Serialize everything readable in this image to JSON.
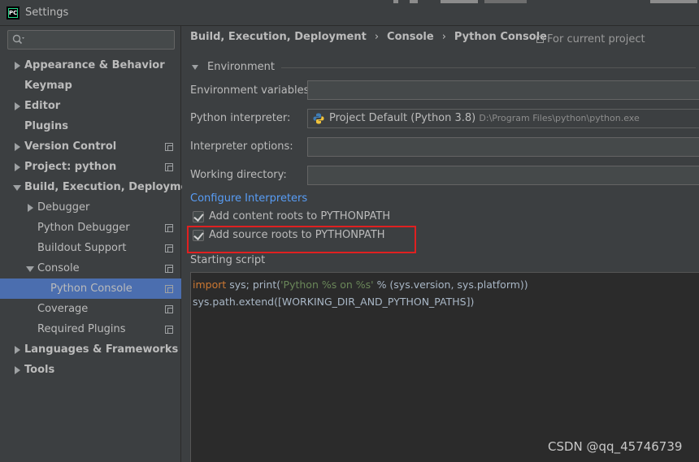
{
  "window": {
    "title": "Settings"
  },
  "search": {
    "placeholder": "",
    "value": ""
  },
  "tree": [
    {
      "label": "Appearance & Behavior",
      "bold": true,
      "expand": "right",
      "indent": 0,
      "copy": false
    },
    {
      "label": "Keymap",
      "bold": true,
      "expand": "none",
      "indent": 0,
      "copy": false
    },
    {
      "label": "Editor",
      "bold": true,
      "expand": "right",
      "indent": 0,
      "copy": false
    },
    {
      "label": "Plugins",
      "bold": true,
      "expand": "none",
      "indent": 0,
      "copy": false
    },
    {
      "label": "Version Control",
      "bold": true,
      "expand": "right",
      "indent": 0,
      "copy": true
    },
    {
      "label": "Project: python",
      "bold": true,
      "expand": "right",
      "indent": 0,
      "copy": true
    },
    {
      "label": "Build, Execution, Deployment",
      "bold": true,
      "expand": "down",
      "indent": 0,
      "copy": false
    },
    {
      "label": "Debugger",
      "bold": false,
      "expand": "right",
      "indent": 1,
      "copy": false
    },
    {
      "label": "Python Debugger",
      "bold": false,
      "expand": "none",
      "indent": 1,
      "copy": true
    },
    {
      "label": "Buildout Support",
      "bold": false,
      "expand": "none",
      "indent": 1,
      "copy": true
    },
    {
      "label": "Console",
      "bold": false,
      "expand": "down",
      "indent": 1,
      "copy": true
    },
    {
      "label": "Python Console",
      "bold": false,
      "expand": "none",
      "indent": 2,
      "copy": true,
      "selected": true
    },
    {
      "label": "Coverage",
      "bold": false,
      "expand": "none",
      "indent": 1,
      "copy": true
    },
    {
      "label": "Required Plugins",
      "bold": false,
      "expand": "none",
      "indent": 1,
      "copy": true
    },
    {
      "label": "Languages & Frameworks",
      "bold": true,
      "expand": "right",
      "indent": 0,
      "copy": false
    },
    {
      "label": "Tools",
      "bold": true,
      "expand": "right",
      "indent": 0,
      "copy": false
    }
  ],
  "breadcrumb": {
    "items": [
      "Build, Execution, Deployment",
      "Console",
      "Python Console"
    ],
    "separator": "›"
  },
  "scope": {
    "label": "For current project"
  },
  "environment": {
    "section_title": "Environment",
    "env_vars_label": "Environment variables:",
    "env_vars_value": "",
    "interpreter_label": "Python interpreter:",
    "interpreter_name": "Project Default (Python 3.8)",
    "interpreter_path": "D:\\Program Files\\python\\python.exe",
    "interpreter_options_label": "Interpreter options:",
    "interpreter_options_value": "",
    "working_dir_label": "Working directory:",
    "working_dir_value": "",
    "configure_link": "Configure Interpreters",
    "content_roots_label": "Add content roots to PYTHONPATH",
    "content_roots_checked": true,
    "source_roots_label": "Add source roots to PYTHONPATH",
    "source_roots_checked": true
  },
  "script": {
    "label": "Starting script",
    "line1_kw": "import",
    "line1_a": " sys; print(",
    "line1_str": "'Python %s on %s'",
    "line1_b": " % (sys.version, sys.platform))",
    "line2": "sys.path.extend([WORKING_DIR_AND_PYTHON_PATHS])"
  },
  "watermark": "CSDN @qq_45746739",
  "colors": {
    "background": "#3c3f41",
    "selection": "#4b6eaf",
    "link": "#589df6",
    "editor_bg": "#2b2b2b",
    "keyword": "#cc7832",
    "string": "#6a8759",
    "highlight_box": "#e02020"
  }
}
